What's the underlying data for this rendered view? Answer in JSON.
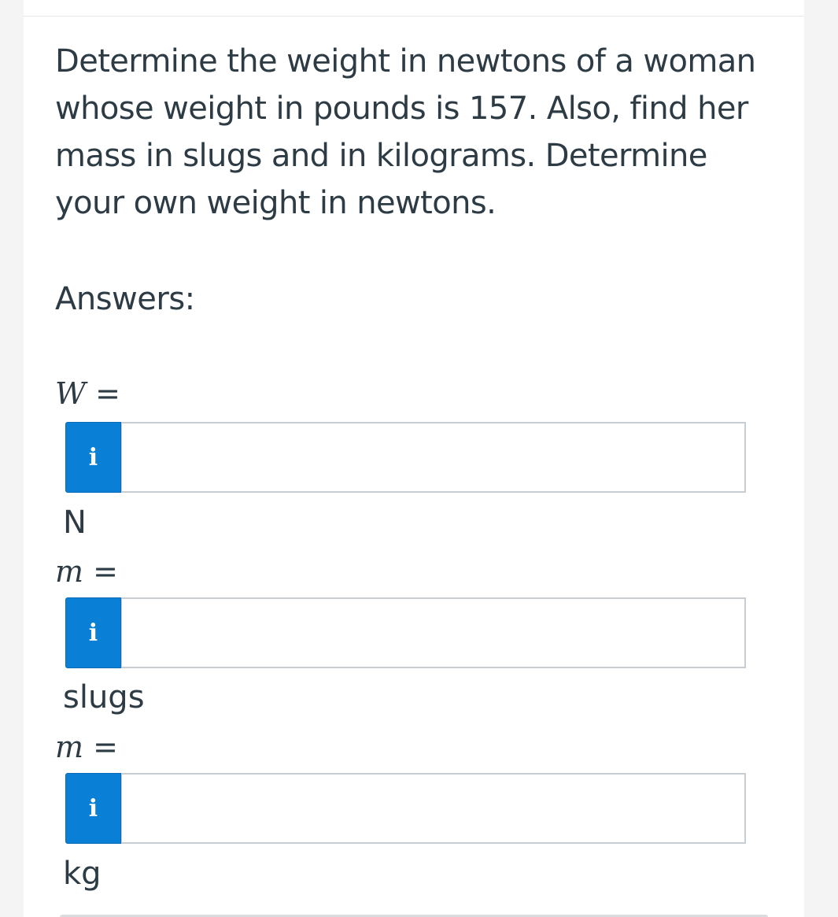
{
  "question": {
    "text": "Determine the weight in newtons of a woman whose weight in pounds is 157. Also, find her mass in slugs and in kilograms. Determine your own weight in newtons."
  },
  "answers_label": "Answers:",
  "answers": [
    {
      "variable": "W",
      "equals": "=",
      "info_label": "i",
      "value": "",
      "unit": "N"
    },
    {
      "variable": "m",
      "equals": "=",
      "info_label": "i",
      "value": "",
      "unit": "slugs"
    },
    {
      "variable": "m",
      "equals": "=",
      "info_label": "i",
      "value": "",
      "unit": "kg"
    }
  ],
  "colors": {
    "info_button": "#0a7fd6",
    "text": "#2d3b45",
    "input_border": "#c7cdd1"
  },
  "icons": {
    "info": "info-icon"
  }
}
